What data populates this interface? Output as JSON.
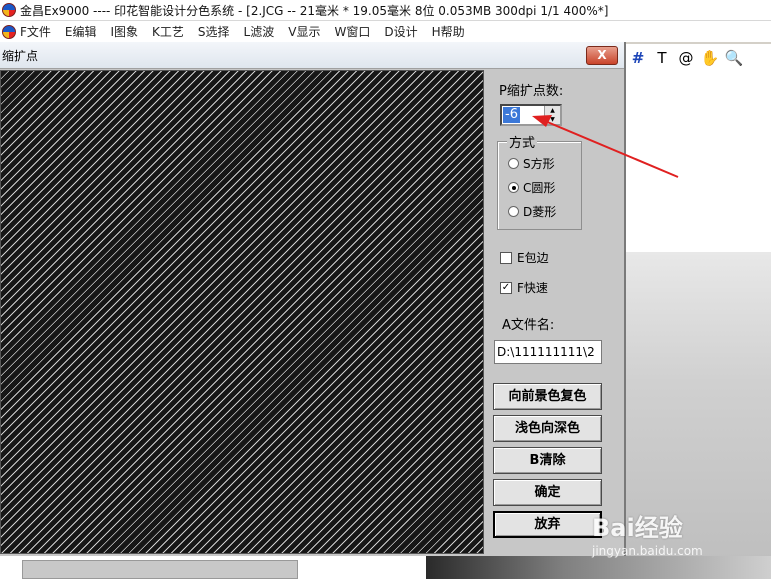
{
  "window": {
    "title": "金昌Ex9000 ---- 印花智能设计分色系统 - [2.JCG -- 21毫米 * 19.05毫米 8位   0.053MB 300dpi 1/1    400%*]"
  },
  "menu": {
    "items": [
      "F文件",
      "E编辑",
      "I图象",
      "K工艺",
      "S选择",
      "L滤波",
      "V显示",
      "W窗口",
      "D设计",
      "H帮助"
    ]
  },
  "toolbar": {
    "icons": [
      "grid-icon",
      "text-icon",
      "spiral-icon",
      "hand-icon",
      "magnifier-icon"
    ],
    "glyphs": [
      "#",
      "T",
      "@",
      "✋",
      "🔍"
    ]
  },
  "dialog": {
    "title": "缩扩点",
    "close_label": "X",
    "points_label": "P缩扩点数:",
    "points_value": "-6",
    "mode_group_label": "方式",
    "mode_options": [
      {
        "label": "S方形",
        "checked": false
      },
      {
        "label": "C圆形",
        "checked": true
      },
      {
        "label": "D菱形",
        "checked": false
      }
    ],
    "wrap_label": "E包边",
    "wrap_checked": false,
    "fast_label": "F快速",
    "fast_checked": true,
    "filename_label": "A文件名:",
    "filename_value": "D:\\111111111\\2",
    "buttons": [
      "向前景色复色",
      "浅色向深色",
      "B清除",
      "确定",
      "放弃"
    ]
  },
  "watermark": {
    "logo": "Bai经验",
    "url": "jingyan.baidu.com"
  },
  "colors": {
    "annotation_arrow": "#e02020",
    "selection": "#3b78d8",
    "dialog_bg": "#c7c7c7"
  }
}
